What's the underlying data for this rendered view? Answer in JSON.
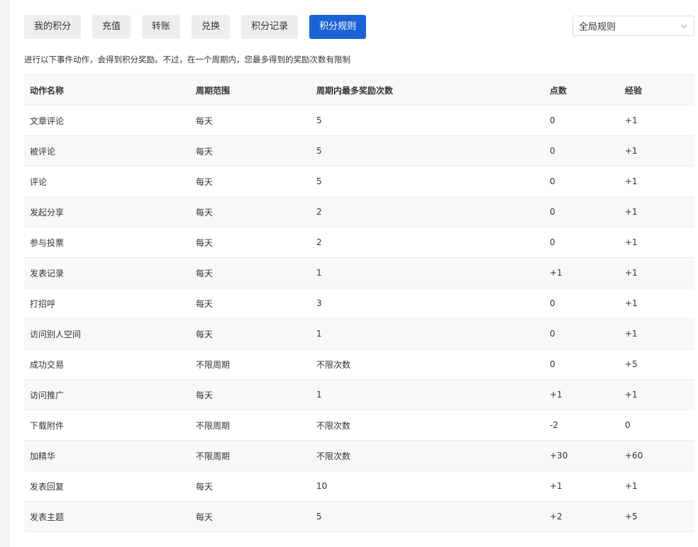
{
  "tabs": [
    {
      "label": "我的积分",
      "active": false
    },
    {
      "label": "充值",
      "active": false
    },
    {
      "label": "转账",
      "active": false
    },
    {
      "label": "兑换",
      "active": false
    },
    {
      "label": "积分记录",
      "active": false
    },
    {
      "label": "积分规则",
      "active": true
    }
  ],
  "scope_select": {
    "value": "全局规则",
    "icon": "chevron-down-icon"
  },
  "intro": "进行以下事件动作，会得到积分奖励。不过，在一个周期内，您最多得到的奖励次数有限制",
  "table": {
    "headers": [
      "动作名称",
      "周期范围",
      "周期内最多奖励次数",
      "点数",
      "经验"
    ],
    "rows": [
      [
        "文章评论",
        "每天",
        "5",
        "0",
        "+1"
      ],
      [
        "被评论",
        "每天",
        "5",
        "0",
        "+1"
      ],
      [
        "评论",
        "每天",
        "5",
        "0",
        "+1"
      ],
      [
        "发起分享",
        "每天",
        "2",
        "0",
        "+1"
      ],
      [
        "参与投票",
        "每天",
        "2",
        "0",
        "+1"
      ],
      [
        "发表记录",
        "每天",
        "1",
        "+1",
        "+1"
      ],
      [
        "打招呼",
        "每天",
        "3",
        "0",
        "+1"
      ],
      [
        "访问别人空间",
        "每天",
        "1",
        "0",
        "+1"
      ],
      [
        "成功交易",
        "不限周期",
        "不限次数",
        "0",
        "+5"
      ],
      [
        "访问推广",
        "每天",
        "1",
        "+1",
        "+1"
      ],
      [
        "下载附件",
        "不限周期",
        "不限次数",
        "-2",
        "0"
      ],
      [
        "加精华",
        "不限周期",
        "不限次数",
        "+30",
        "+60"
      ],
      [
        "发表回复",
        "每天",
        "10",
        "+1",
        "+1"
      ],
      [
        "发表主题",
        "每天",
        "5",
        "+2",
        "+5"
      ]
    ]
  },
  "colors": {
    "accent": "#1a63d6",
    "tab_bg": "#eeeeee",
    "row_alt": "#f8f8f8"
  }
}
